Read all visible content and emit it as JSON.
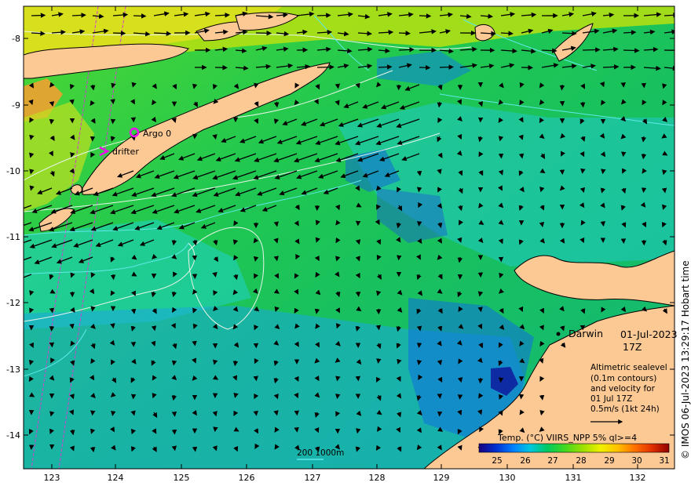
{
  "map": {
    "x_ticks": [
      "123",
      "124",
      "125",
      "126",
      "127",
      "128",
      "129",
      "130",
      "131",
      "132"
    ],
    "y_ticks": [
      "-8",
      "-9",
      "-10",
      "-11",
      "-12",
      "-13",
      "-14"
    ],
    "lon_range": [
      122.6,
      132.7
    ],
    "lat_range": [
      -14.55,
      -7.6
    ]
  },
  "markers": {
    "argo_label": "Argo 0",
    "drifter_label": "drifter"
  },
  "place": {
    "darwin": "Darwin",
    "date": "01-Jul-2023",
    "hour": "17Z"
  },
  "legend": {
    "line1": "Altimetric sealevel",
    "line2": "(0.1m contours)",
    "line3": "and velocity for",
    "line4": "01 Jul 17Z",
    "line5": "0.5m/s (1kt 24h)"
  },
  "scale": {
    "depth_label": "200  1000m"
  },
  "colorbar": {
    "title": "Temp. (°C) VIIRS_NPP 5% ql>=4",
    "ticks": [
      "25",
      "26",
      "27",
      "28",
      "29",
      "30",
      "31"
    ],
    "colors": [
      "#1a0080",
      "#0030d0",
      "#0080ff",
      "#00c8e0",
      "#00c860",
      "#40d820",
      "#a0e000",
      "#f0f000",
      "#ffc000",
      "#ff7000",
      "#e03000",
      "#900000"
    ]
  },
  "credit": "© IMOS 06-Jul-2023 13:29:17 Hobart time",
  "colors": {
    "land": "#fcc995",
    "marker": "#ee10ee",
    "contour_white": "#e8f4e8",
    "contour_cyan": "#60e8e8",
    "arrow": "#000000"
  }
}
